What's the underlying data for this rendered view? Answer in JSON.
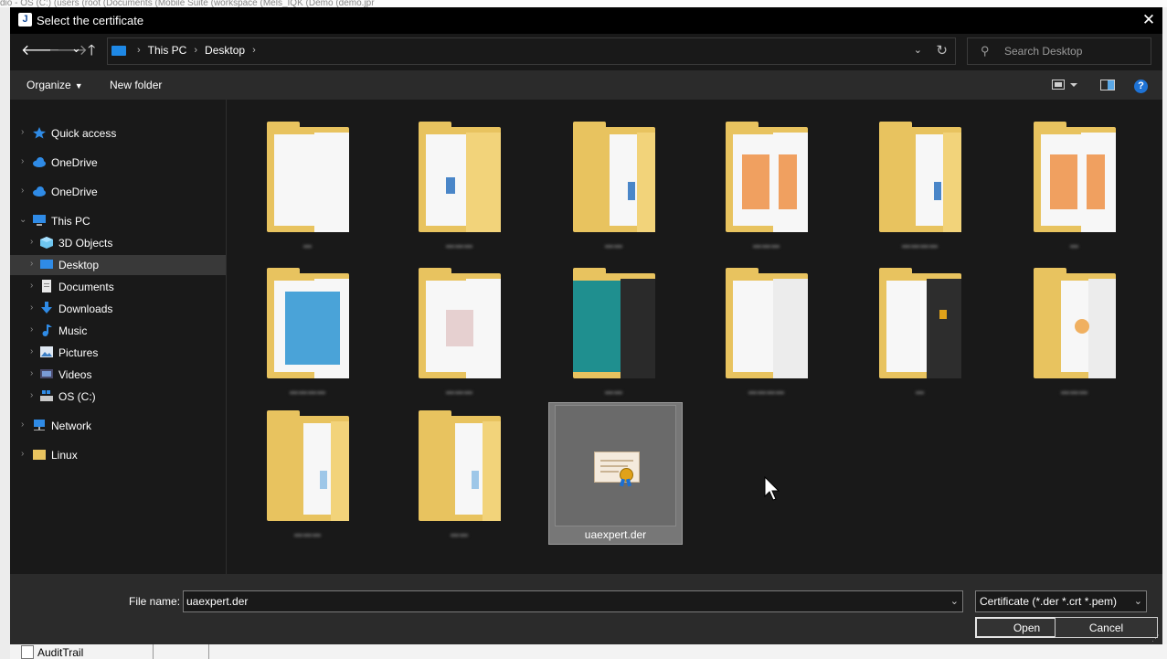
{
  "background": {
    "path_text": "dio - OS (C:) (users (root (Documents (Mobile Suite (workspace (Mels_IQK (Demo (demo.jpr",
    "bottom_item": "AuditTrail"
  },
  "dialog": {
    "title": "Select the certificate",
    "close_icon": "✕"
  },
  "navbar": {
    "back_icon": "🡐",
    "forward_icon": "🡒",
    "recent_icon": "⌄",
    "up_icon": "🡑",
    "breadcrumb": [
      "This PC",
      "Desktop"
    ],
    "breadcrumb_sep": "›",
    "dropdown_icon": "⌄",
    "refresh_icon": "↻",
    "search_placeholder": "Search Desktop",
    "search_icon": "⚲"
  },
  "toolbar": {
    "organize": "Organize",
    "new_folder": "New folder",
    "help_icon": "?"
  },
  "sidebar": {
    "items": [
      {
        "label": "Quick access",
        "icon": "star-icon"
      },
      {
        "label": "OneDrive",
        "icon": "cloud-icon"
      },
      {
        "label": "OneDrive",
        "icon": "cloud-icon"
      },
      {
        "label": "This PC",
        "icon": "computer-icon"
      },
      {
        "label": "3D Objects",
        "icon": "cube-icon"
      },
      {
        "label": "Desktop",
        "icon": "desktop-icon"
      },
      {
        "label": "Documents",
        "icon": "documents-icon"
      },
      {
        "label": "Downloads",
        "icon": "download-icon"
      },
      {
        "label": "Music",
        "icon": "music-icon"
      },
      {
        "label": "Pictures",
        "icon": "pictures-icon"
      },
      {
        "label": "Videos",
        "icon": "videos-icon"
      },
      {
        "label": "OS (C:)",
        "icon": "drive-icon"
      },
      {
        "label": "Network",
        "icon": "network-icon"
      },
      {
        "label": "Linux",
        "icon": "folder-icon"
      }
    ],
    "selected": "Desktop"
  },
  "files": {
    "selected_file": "uaexpert.der",
    "folder_count": 14
  },
  "bottom": {
    "file_name_label": "File name:",
    "file_name_value": "uaexpert.der",
    "filter_value": "Certificate (*.der *.crt *.pem)",
    "open_label": "Open",
    "cancel_label": "Cancel"
  },
  "colors": {
    "dialog_bg": "#202020",
    "titlebar": "#000000",
    "folder": "#e8c35f",
    "accent_blue": "#1e88e5"
  }
}
